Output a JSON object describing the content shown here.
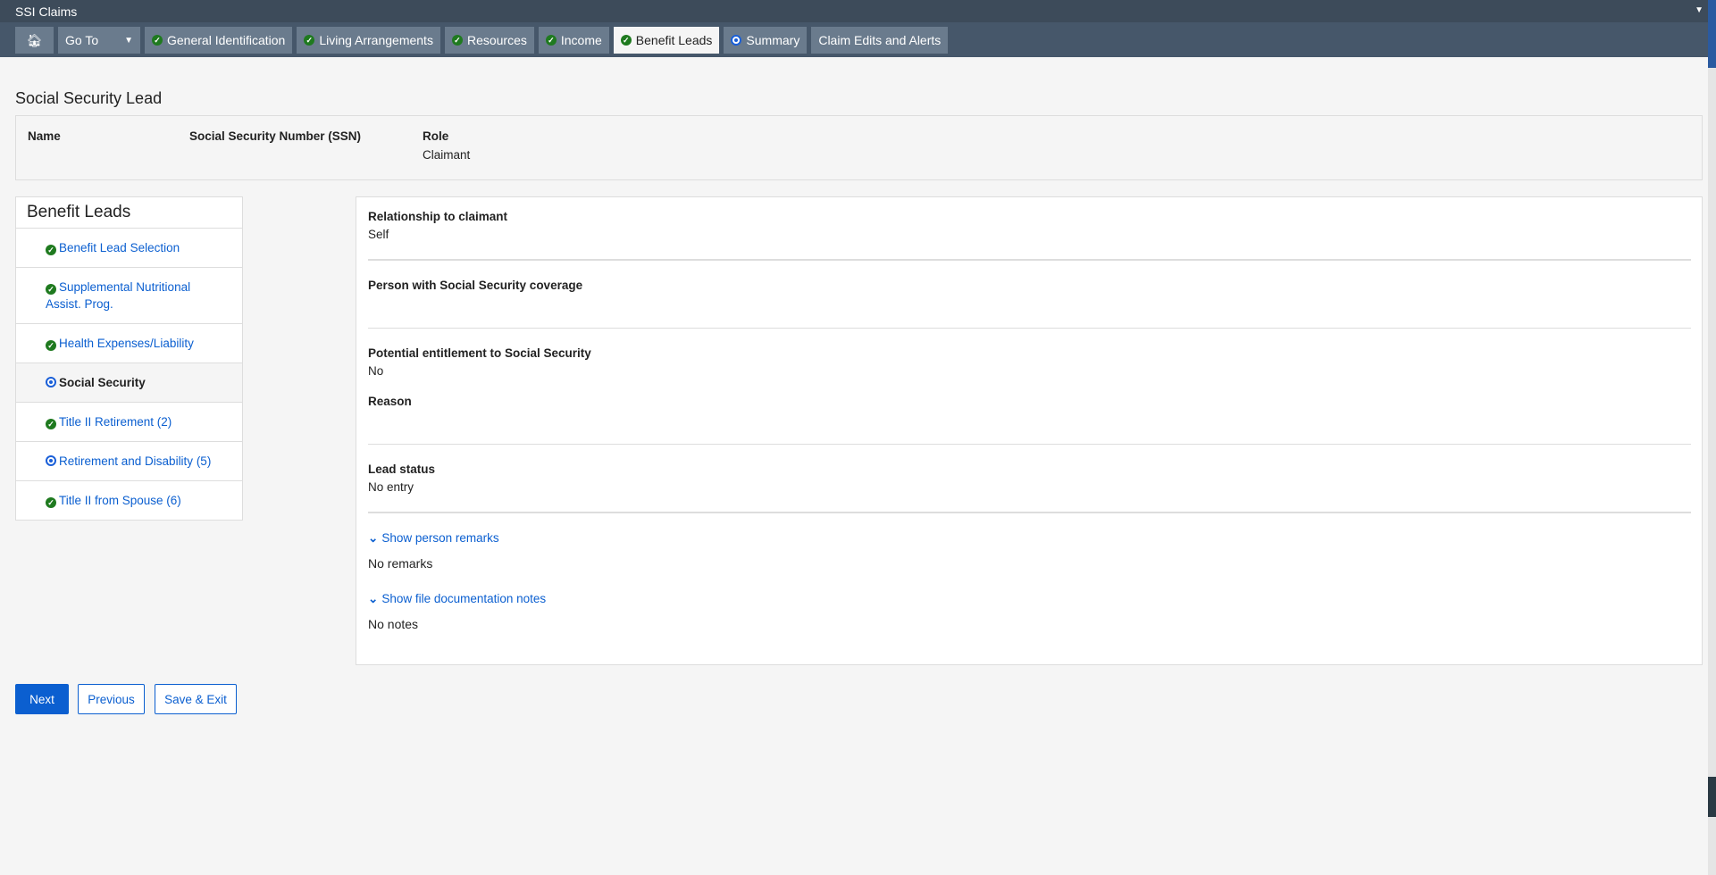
{
  "app": {
    "title": "SSI Claims"
  },
  "nav": {
    "goto": "Go To",
    "tabs": [
      {
        "label": "General Identification",
        "status": "complete"
      },
      {
        "label": "Living Arrangements",
        "status": "complete"
      },
      {
        "label": "Resources",
        "status": "complete"
      },
      {
        "label": "Income",
        "status": "complete"
      },
      {
        "label": "Benefit Leads",
        "status": "complete",
        "active": true
      },
      {
        "label": "Summary",
        "status": "in-progress"
      },
      {
        "label": "Claim Edits and Alerts",
        "status": "none"
      }
    ]
  },
  "page": {
    "title": "Social Security Lead"
  },
  "info": {
    "name_label": "Name",
    "ssn_label": "Social Security Number (SSN)",
    "role_label": "Role",
    "role_value": "Claimant"
  },
  "leftnav": {
    "title": "Benefit Leads",
    "items": [
      {
        "label": "Benefit Lead Selection",
        "status": "complete"
      },
      {
        "label": "Supplemental Nutritional Assist. Prog.",
        "status": "complete"
      },
      {
        "label": "Health Expenses/Liability",
        "status": "complete"
      },
      {
        "label": "Social Security",
        "status": "in-progress",
        "current": true
      },
      {
        "label": "Title II Retirement (2)",
        "status": "complete"
      },
      {
        "label": "Retirement and Disability (5)",
        "status": "in-progress"
      },
      {
        "label": "Title II from Spouse (6)",
        "status": "complete"
      }
    ]
  },
  "panel": {
    "relationship_label": "Relationship to claimant",
    "relationship_value": "Self",
    "coverage_label": "Person with Social Security coverage",
    "entitlement_label": "Potential entitlement to Social Security",
    "entitlement_value": "No",
    "reason_label": "Reason",
    "status_label": "Lead status",
    "status_value": "No entry",
    "remarks_link": "Show person remarks",
    "remarks_value": "No remarks",
    "notes_link": "Show file documentation notes",
    "notes_value": "No notes"
  },
  "buttons": {
    "next": "Next",
    "previous": "Previous",
    "save_exit": "Save & Exit"
  },
  "colors": {
    "complete": "#1f7a1f",
    "in_progress": "#1a5fd8",
    "link": "#0b5fd0"
  }
}
